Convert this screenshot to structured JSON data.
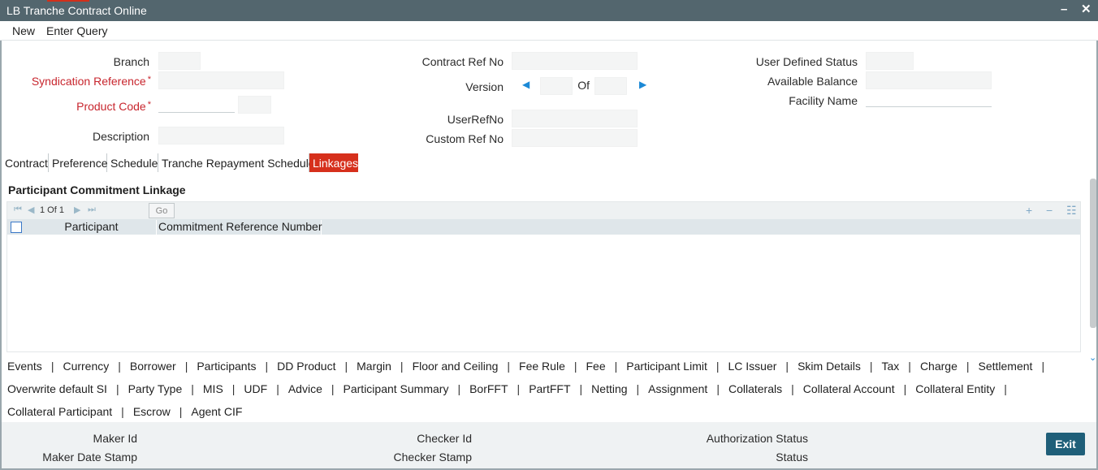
{
  "window": {
    "title": "LB Tranche Contract Online",
    "minimize_symbol": "–",
    "close_symbol": "✕"
  },
  "menu": {
    "items": [
      "New",
      "Enter Query"
    ]
  },
  "header_fields": {
    "branch": {
      "label": "Branch",
      "value": ""
    },
    "syndication_reference": {
      "label": "Syndication Reference",
      "required_mark": "*",
      "value": ""
    },
    "product_code": {
      "label": "Product Code",
      "required_mark": "*",
      "value": ""
    },
    "description": {
      "label": "Description",
      "value": ""
    },
    "contract_ref_no": {
      "label": "Contract Ref No",
      "value": ""
    },
    "version": {
      "label": "Version",
      "of_label": "Of",
      "value": "",
      "of_value": ""
    },
    "user_ref_no": {
      "label": "UserRefNo",
      "value": ""
    },
    "custom_ref_no": {
      "label": "Custom Ref No",
      "value": ""
    },
    "user_defined_status": {
      "label": "User Defined Status",
      "value": ""
    },
    "available_balance": {
      "label": "Available Balance",
      "value": ""
    },
    "facility_name": {
      "label": "Facility Name",
      "value": ""
    }
  },
  "tabs": [
    {
      "label": "Contract",
      "active": false
    },
    {
      "label": "Preference",
      "active": false
    },
    {
      "label": "Schedule",
      "active": false
    },
    {
      "label": "Tranche Repayment Schedules",
      "active": false
    },
    {
      "label": "Linkages",
      "active": true
    }
  ],
  "section": {
    "title": "Participant Commitment Linkage",
    "pagination": {
      "text": "1 Of 1",
      "go_label": "Go"
    },
    "columns": [
      "Participant",
      "Commitment Reference Number"
    ],
    "rows": []
  },
  "bottom_links": {
    "row1": [
      "Events",
      "Currency",
      "Borrower",
      "Participants",
      "DD Product",
      "Margin",
      "Floor and Ceiling",
      "Fee Rule",
      "Fee",
      "Participant Limit",
      "LC Issuer",
      "Skim Details",
      "Tax",
      "Charge",
      "Settlement"
    ],
    "row2": [
      "Overwrite default SI",
      "Party Type",
      "MIS",
      "UDF",
      "Advice",
      "Participant Summary",
      "BorFFT",
      "PartFFT",
      "Netting",
      "Assignment",
      "Collaterals",
      "Collateral Account",
      "Collateral Entity"
    ],
    "row3": [
      "Collateral Participant",
      "Escrow",
      "Agent CIF"
    ]
  },
  "footer": {
    "maker_id": "Maker Id",
    "maker_date_stamp": "Maker Date Stamp",
    "checker_id": "Checker Id",
    "checker_stamp": "Checker Stamp",
    "authorization_status": "Authorization Status",
    "status": "Status",
    "exit_label": "Exit"
  }
}
